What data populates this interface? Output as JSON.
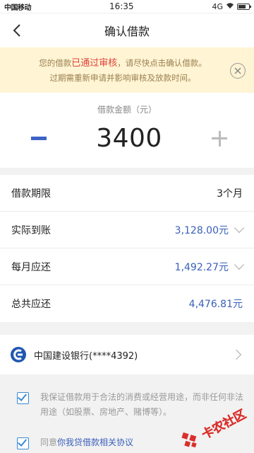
{
  "status_bar": {
    "carrier": "中国移动",
    "time": "16:35",
    "network": "4G"
  },
  "nav": {
    "title": "确认借款",
    "back_icon": "chevron-left-icon"
  },
  "notice": {
    "prefix": "您的借款",
    "highlight": "已通过审核",
    "suffix": "，请尽快点击确认借款。",
    "line2": "过期需重新申请并影响审核及放款时间。",
    "close_icon": "close-circle-icon"
  },
  "amount": {
    "label": "借款金额（元）",
    "value": "3400"
  },
  "details": {
    "term": {
      "label": "借款期限",
      "value": "3个月"
    },
    "received": {
      "label": "实际到账",
      "value": "3,128.00元"
    },
    "monthly": {
      "label": "每月应还",
      "value": "1,492.27元"
    },
    "total": {
      "label": "总共应还",
      "value": "4,476.81元"
    }
  },
  "bank": {
    "name": "中国建设银行(****4392)",
    "icon": "bank-logo-icon"
  },
  "agreements": {
    "purpose": "我保证借款用于合法的消费或经营用途，而非任何非法用途（如股票、房地产、赌博等）。",
    "protocol_prefix": "同意",
    "protocol_link": "你我贷借款相关协议"
  },
  "watermark": {
    "text": "卡农社区"
  },
  "colors": {
    "accent_blue": "#3a5fba",
    "notice_bg": "#fff4d4",
    "notice_highlight": "#e0433b",
    "watermark_red": "#d9302c"
  }
}
